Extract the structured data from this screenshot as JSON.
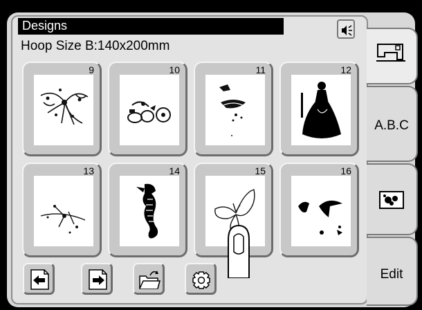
{
  "screen": {
    "title": "Designs",
    "hoop_size": "Hoop Size B:140x200mm"
  },
  "header": {
    "sound_icon": "speaker-icon"
  },
  "designs": [
    {
      "number": "9",
      "motif": "floral-bow"
    },
    {
      "number": "10",
      "motif": "fruit-basket"
    },
    {
      "number": "11",
      "motif": "crane-nest"
    },
    {
      "number": "12",
      "motif": "lady-in-gown"
    },
    {
      "number": "13",
      "motif": "scattered-sprig"
    },
    {
      "number": "14",
      "motif": "seahorse"
    },
    {
      "number": "15",
      "motif": "butterfly"
    },
    {
      "number": "16",
      "motif": "birds"
    }
  ],
  "toolbar": {
    "prev_icon": "page-previous-icon",
    "next_icon": "page-next-icon",
    "open_icon": "open-folder-icon",
    "settings_icon": "gear-icon"
  },
  "side_tabs": {
    "machine_icon": "sewing-machine-icon",
    "abc_label": "A.B.C",
    "picture_icon": "picture-design-icon",
    "edit_label": "Edit"
  },
  "colors": {
    "panel": "#d8d8d8",
    "title_bar": "#000000",
    "title_text": "#ffffff"
  }
}
